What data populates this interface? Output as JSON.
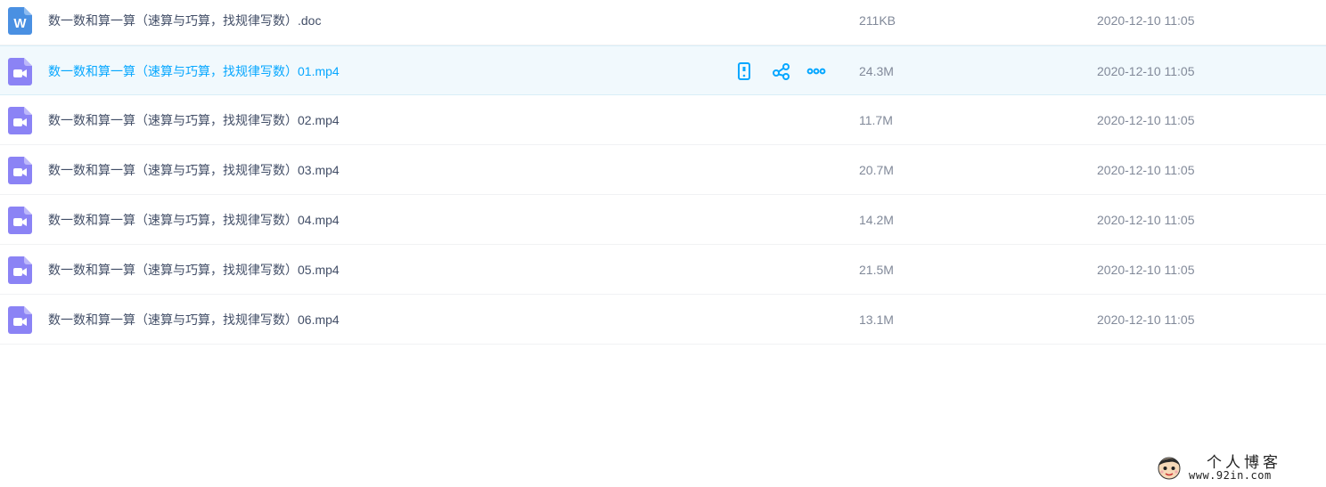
{
  "files": [
    {
      "type": "doc",
      "icon": "word-doc-icon",
      "name": "数一数和算一算（速算与巧算，找规律写数）.doc",
      "size": "211KB",
      "modified": "2020-12-10 11:05",
      "hovered": false
    },
    {
      "type": "video",
      "icon": "video-file-icon",
      "name": "数一数和算一算（速算与巧算，找规律写数）01.mp4",
      "size": "24.3M",
      "modified": "2020-12-10 11:05",
      "hovered": true
    },
    {
      "type": "video",
      "icon": "video-file-icon",
      "name": "数一数和算一算（速算与巧算，找规律写数）02.mp4",
      "size": "11.7M",
      "modified": "2020-12-10 11:05",
      "hovered": false
    },
    {
      "type": "video",
      "icon": "video-file-icon",
      "name": "数一数和算一算（速算与巧算，找规律写数）03.mp4",
      "size": "20.7M",
      "modified": "2020-12-10 11:05",
      "hovered": false
    },
    {
      "type": "video",
      "icon": "video-file-icon",
      "name": "数一数和算一算（速算与巧算，找规律写数）04.mp4",
      "size": "14.2M",
      "modified": "2020-12-10 11:05",
      "hovered": false
    },
    {
      "type": "video",
      "icon": "video-file-icon",
      "name": "数一数和算一算（速算与巧算，找规律写数）05.mp4",
      "size": "21.5M",
      "modified": "2020-12-10 11:05",
      "hovered": false
    },
    {
      "type": "video",
      "icon": "video-file-icon",
      "name": "数一数和算一算（速算与巧算，找规律写数）06.mp4",
      "size": "13.1M",
      "modified": "2020-12-10 11:05",
      "hovered": false
    }
  ],
  "row_actions": [
    {
      "name": "phone-icon"
    },
    {
      "name": "share-icon"
    },
    {
      "name": "more-icon"
    }
  ],
  "colors": {
    "accent": "#06a7ff",
    "text": "#424e67",
    "meta_text": "#818999",
    "hover_bg": "#f1f9fd",
    "doc_icon": "#4a90e2",
    "video_icon": "#8b83f5"
  },
  "watermark": {
    "title": "个人博客",
    "url": "www.92in.com"
  }
}
